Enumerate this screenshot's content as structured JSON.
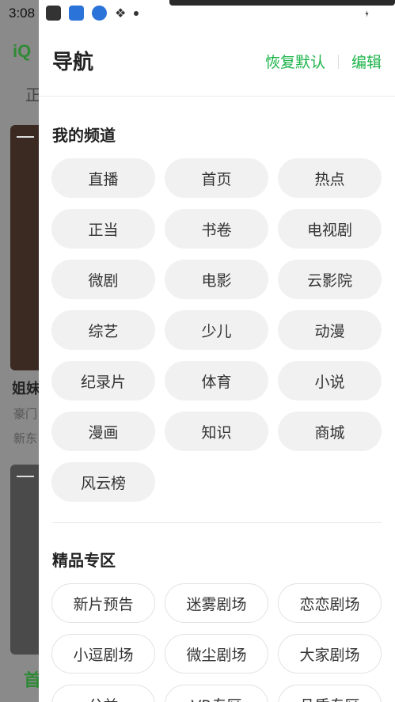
{
  "status_bar": {
    "time": "3:08"
  },
  "background_app": {
    "logo": "iQ",
    "tab": "正",
    "card_title": "姐妹",
    "card_line1": "豪门",
    "card_line2": "新东",
    "bottom_nav": "首"
  },
  "drawer": {
    "title": "导航",
    "restore_default": "恢复默认",
    "edit": "编辑",
    "my_channels": {
      "title": "我的频道",
      "items": [
        "直播",
        "首页",
        "热点",
        "正当",
        "书卷",
        "电视剧",
        "微剧",
        "电影",
        "云影院",
        "综艺",
        "少儿",
        "动漫",
        "纪录片",
        "体育",
        "小说",
        "漫画",
        "知识",
        "商城",
        "风云榜"
      ]
    },
    "premium": {
      "title": "精品专区",
      "items": [
        "新片预告",
        "迷雾剧场",
        "恋恋剧场",
        "小逗剧场",
        "微尘剧场",
        "大家剧场",
        "公益",
        "VR专区",
        "品质专区"
      ]
    }
  },
  "colors": {
    "accent": "#1cb44a",
    "chip_bg": "#f1f1f1"
  }
}
